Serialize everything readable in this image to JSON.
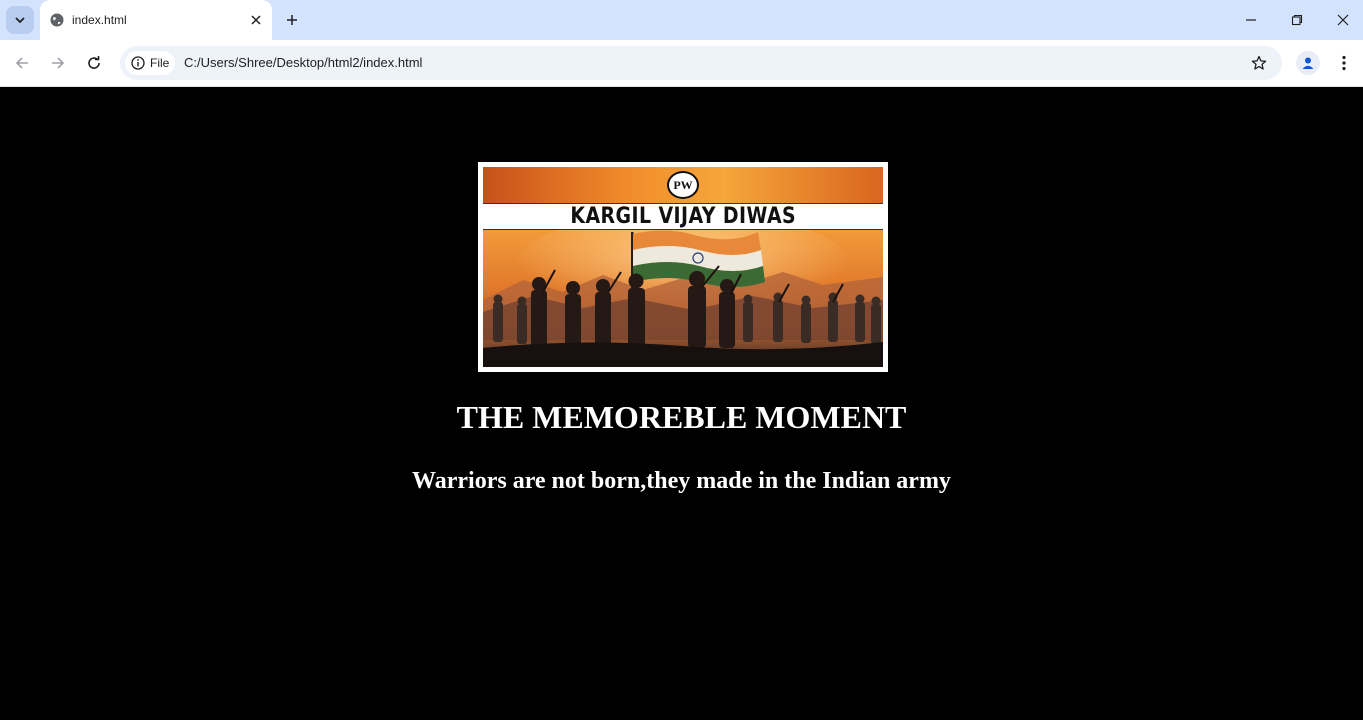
{
  "browser": {
    "tab": {
      "title": "index.html"
    },
    "address_bar": {
      "chip_label": "File",
      "url": "C:/Users/Shree/Desktop/html2/index.html"
    },
    "icons": {
      "tab_search": "chevron-down-icon",
      "favicon": "globe-icon",
      "tab_close": "close-icon",
      "new_tab": "plus-icon",
      "minimize": "minimize-icon",
      "restore": "restore-icon",
      "close_window": "close-icon",
      "back": "back-arrow-icon",
      "forward": "forward-arrow-icon",
      "reload": "reload-icon",
      "site_info": "info-icon",
      "bookmark": "star-icon",
      "profile": "profile-icon",
      "menu": "kebab-menu-icon"
    }
  },
  "page": {
    "banner": {
      "title": "KARGIL VIJAY DIWAS",
      "logo_text": "PW"
    },
    "heading": "THE MEMOREBLE MOMENT",
    "subheading": "Warriors are not born,they made in the Indian army"
  },
  "colors": {
    "page_background": "#000000",
    "text": "#ffffff",
    "tabstrip": "#d3e3fd",
    "omnibox": "#eef2f9"
  }
}
